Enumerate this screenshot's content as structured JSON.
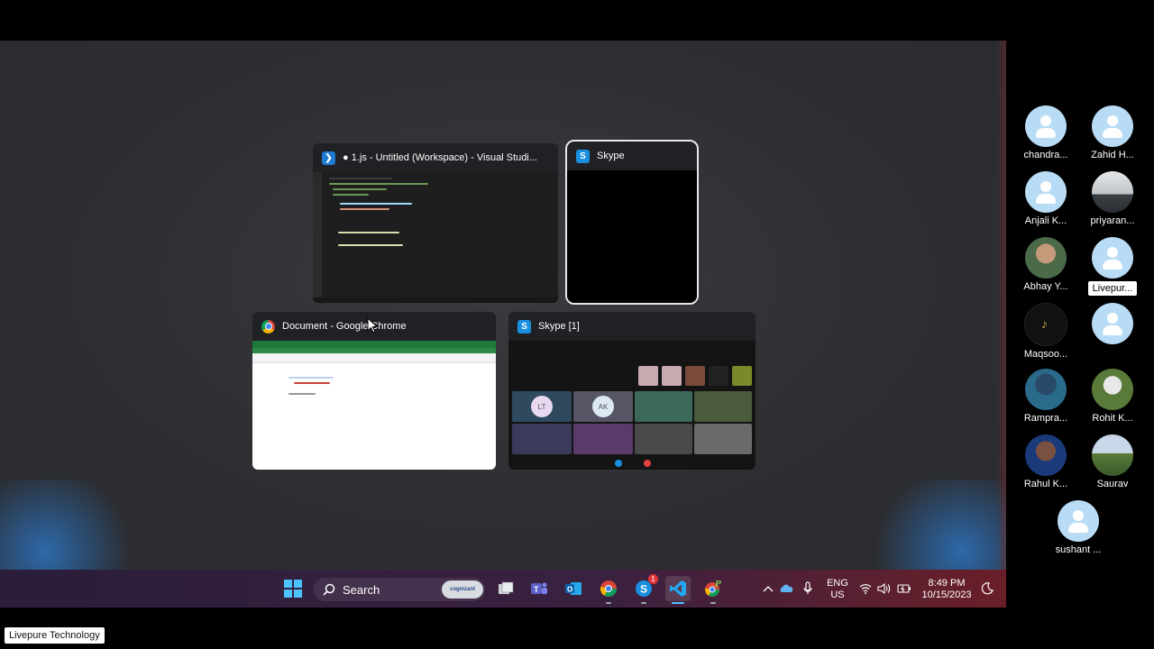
{
  "switcher": {
    "windows": [
      {
        "title": "● 1.js - Untitled (Workspace) - Visual Studi...",
        "icon": "vscode-icon"
      },
      {
        "title": "Skype",
        "icon": "skype-icon",
        "selected": true
      },
      {
        "title": "Document - Google Chrome",
        "icon": "chrome-icon"
      },
      {
        "title": "Skype [1]",
        "icon": "skype-icon"
      }
    ]
  },
  "skype_preview": {
    "tiles": [
      "LT",
      "AK"
    ]
  },
  "participants": [
    {
      "name": "chandra...",
      "avatar": "default"
    },
    {
      "name": "Zahid H...",
      "avatar": "default"
    },
    {
      "name": "Anjali K...",
      "avatar": "default"
    },
    {
      "name": "priyaran...",
      "avatar": "photo"
    },
    {
      "name": "Abhay Y...",
      "avatar": "photo"
    },
    {
      "name": "Livepur...",
      "avatar": "default",
      "highlighted": true
    },
    {
      "name": "Maqsoo...",
      "avatar": "photo"
    },
    {
      "name": "",
      "avatar": "default"
    },
    {
      "name": "Rampra...",
      "avatar": "photo"
    },
    {
      "name": "Rohit K...",
      "avatar": "photo"
    },
    {
      "name": "Rahul K...",
      "avatar": "photo"
    },
    {
      "name": "Saurav",
      "avatar": "photo"
    },
    {
      "name": "sushant ...",
      "avatar": "default"
    }
  ],
  "taskbar": {
    "search_label": "Search",
    "search_badge": "cognizant",
    "skype_badge": "1",
    "language": "ENG",
    "region": "US",
    "time": "8:49 PM",
    "date": "10/15/2023"
  },
  "footer_label": "Livepure Technology",
  "colors": {
    "taskbar_start": "#2a1e3a",
    "taskbar_end": "#6a1f28",
    "avatar_default": "#b9dcf6",
    "skype_blue": "#1a8fe0",
    "vscode_blue": "#1f7ad1",
    "chrome_green": "#1f7a3a"
  }
}
